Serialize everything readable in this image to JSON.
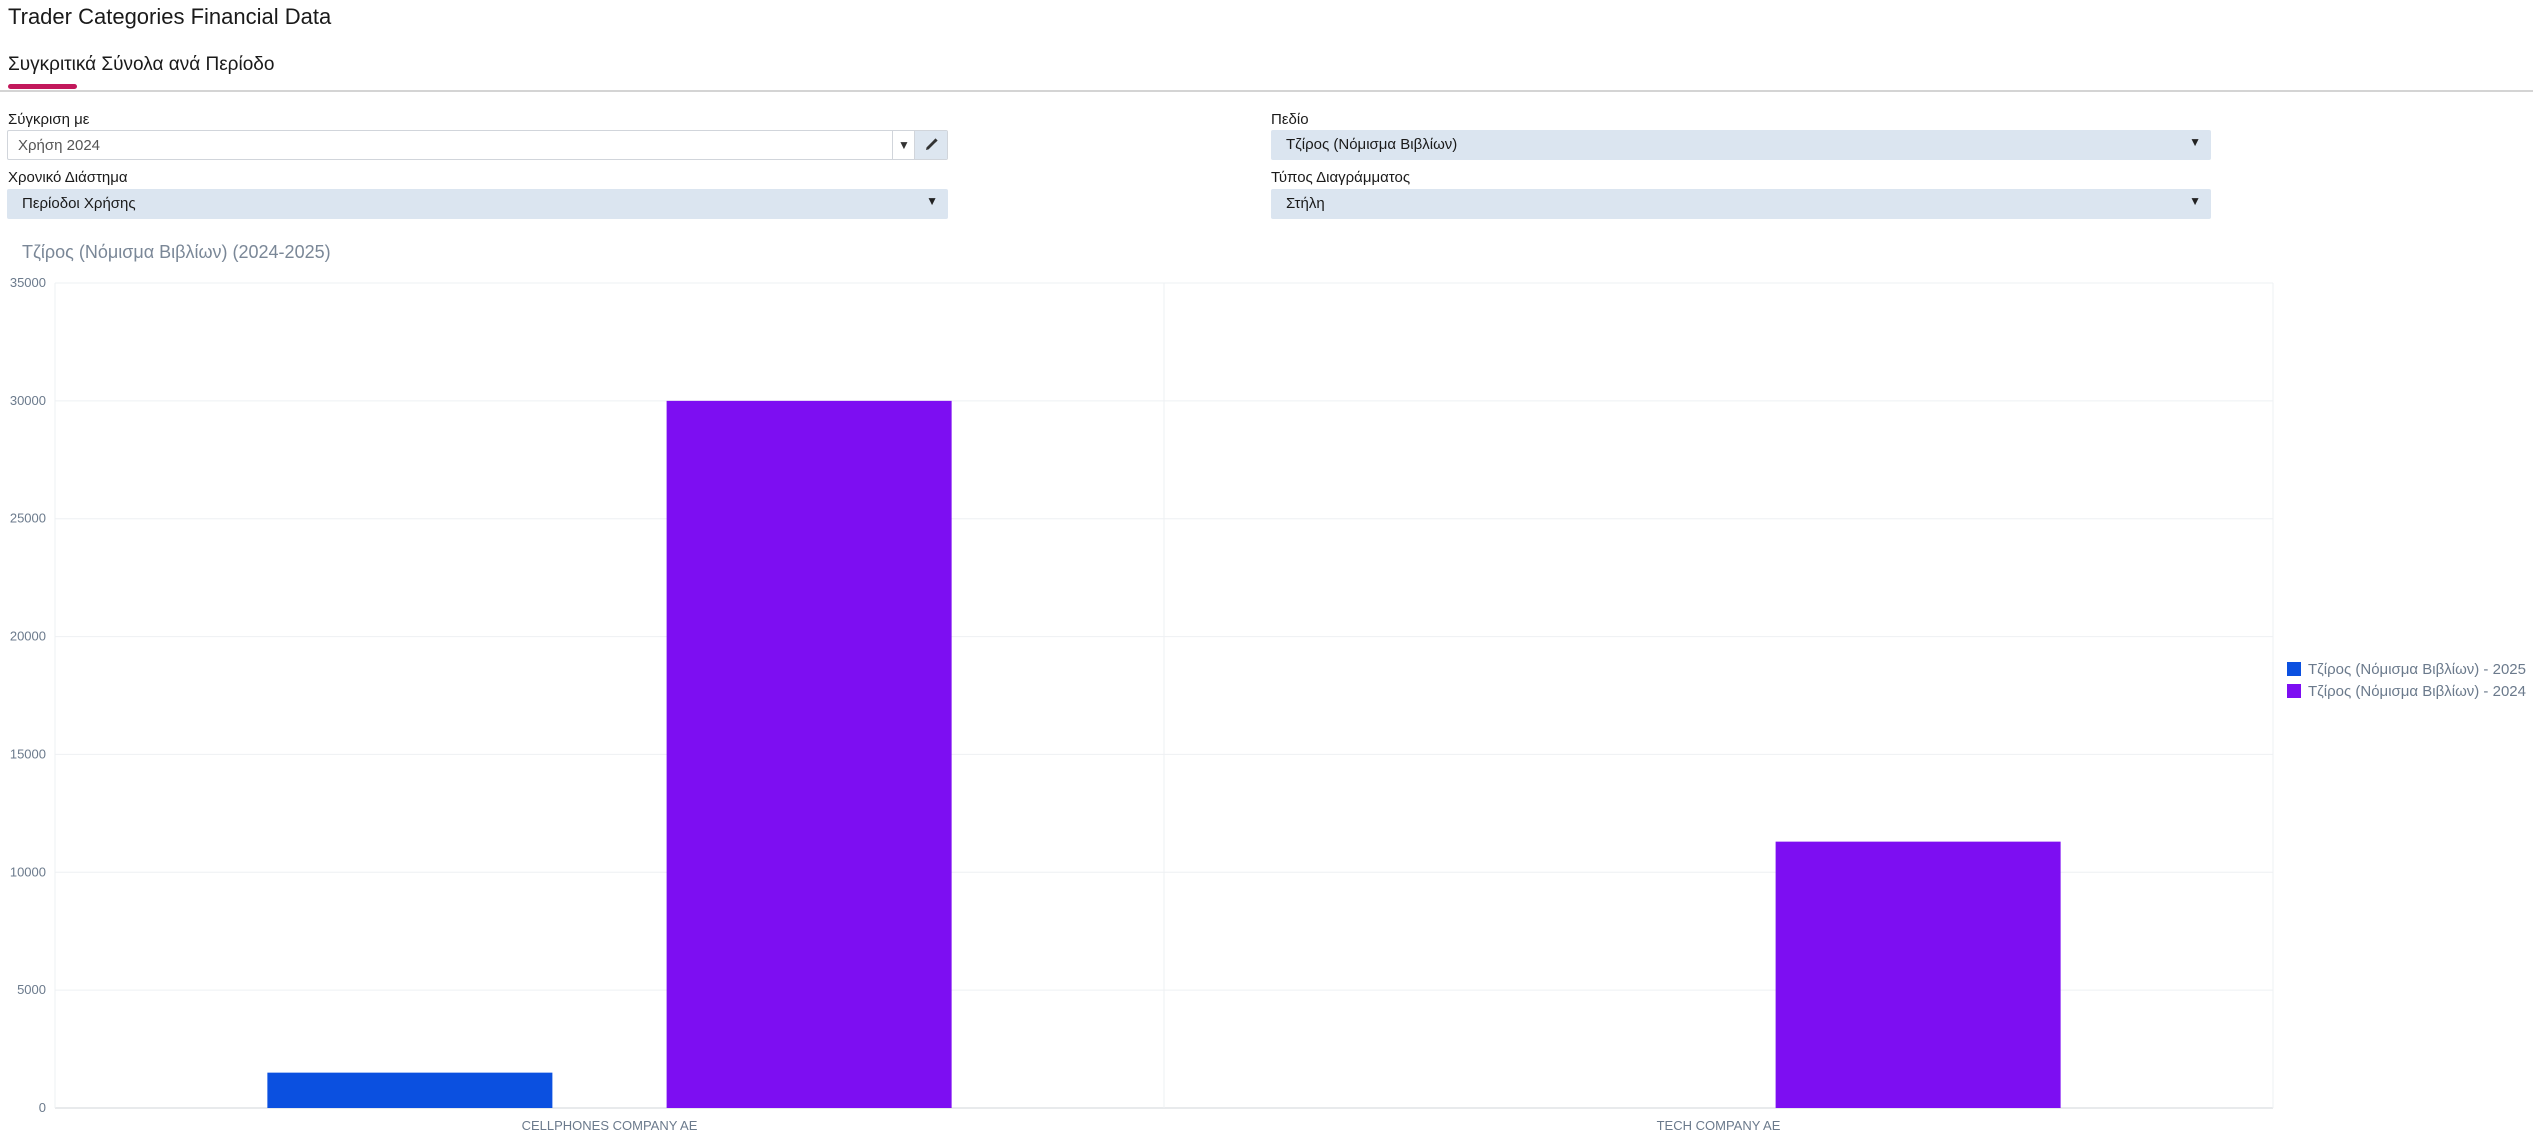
{
  "page": {
    "title": "Trader Categories Financial Data"
  },
  "tabs": [
    {
      "label": "Συγκριτικά Σύνολα ανά Περίοδο",
      "active": true
    }
  ],
  "filters": {
    "compare": {
      "label": "Σύγκριση με",
      "value": "Χρήση 2024",
      "arrow_icon": "chevron-down-icon",
      "edit_icon": "pencil-icon"
    },
    "field": {
      "label": "Πεδίο",
      "value": "Τζίρος (Νόμισμα Βιβλίων)"
    },
    "period": {
      "label": "Χρονικό Διάστημα",
      "value": "Περίοδοι Χρήσης"
    },
    "chart_type": {
      "label": "Τύπος Διαγράμματος",
      "value": "Στήλη"
    }
  },
  "chart_data": {
    "type": "bar",
    "title": "Τζίρος (Νόμισμα Βιβλίων) (2024-2025)",
    "categories": [
      "CELLPHONES COMPANY AE",
      "TECH COMPANY AE"
    ],
    "series": [
      {
        "name": "Τζίρος (Νόμισμα Βιβλίων) - 2025",
        "color": "#0b50e0",
        "values": [
          1500,
          0
        ]
      },
      {
        "name": "Τζίρος (Νόμισμα Βιβλίων) - 2024",
        "color": "#7d0ef2",
        "values": [
          30000,
          11300
        ]
      }
    ],
    "ylim": [
      0,
      35000
    ],
    "yticks": [
      0,
      5000,
      10000,
      15000,
      20000,
      25000,
      30000,
      35000
    ],
    "grid": true,
    "legend_position": "right"
  }
}
